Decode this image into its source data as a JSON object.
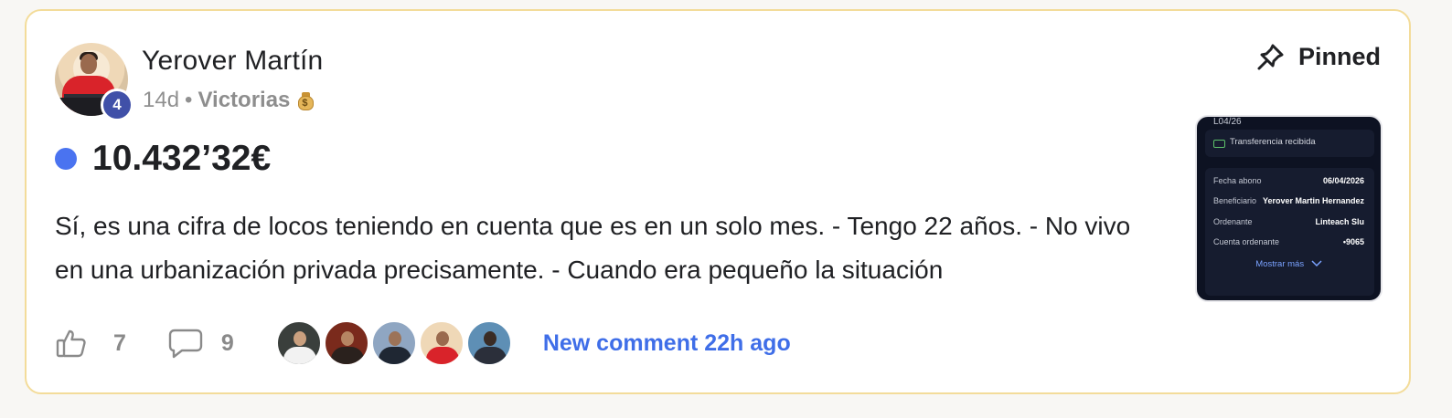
{
  "post": {
    "author_name": "Yerover Martín",
    "author_level": "4",
    "time_ago": "14d",
    "separator": "•",
    "category": "Victorias",
    "category_icon": "money-bag-icon",
    "pinned_label": "Pinned",
    "title": "10.432’32€",
    "body": "Sí, es una cifra de locos teniendo en cuenta que es en un solo mes. - Tengo 22 años. - No vivo en una urbanización privada precisamente. - Cuando era pequeño la situación",
    "likes": "7",
    "comments": "9",
    "new_comment_text": "New comment 22h ago"
  },
  "attachment": {
    "date_fragment": "L04/26",
    "transfer_label": "Transferencia recibida",
    "rows": [
      {
        "label": "Fecha abono",
        "value": "06/04/2026"
      },
      {
        "label": "Beneficiario",
        "value": "Yerover Martin Hernandez"
      },
      {
        "label": "Ordenante",
        "value": "Linteach Slu"
      },
      {
        "label": "Cuenta ordenante",
        "value": "•9065"
      }
    ],
    "show_more": "Mostrar más"
  },
  "colors": {
    "card_border": "#f3dc9a",
    "unread_dot": "#4a73f0",
    "level_badge": "#4050a8",
    "link_blue": "#3f6ee8"
  },
  "icons": {
    "pin": "pin-icon",
    "like": "thumbs-up-icon",
    "comment": "comment-bubble-icon"
  }
}
